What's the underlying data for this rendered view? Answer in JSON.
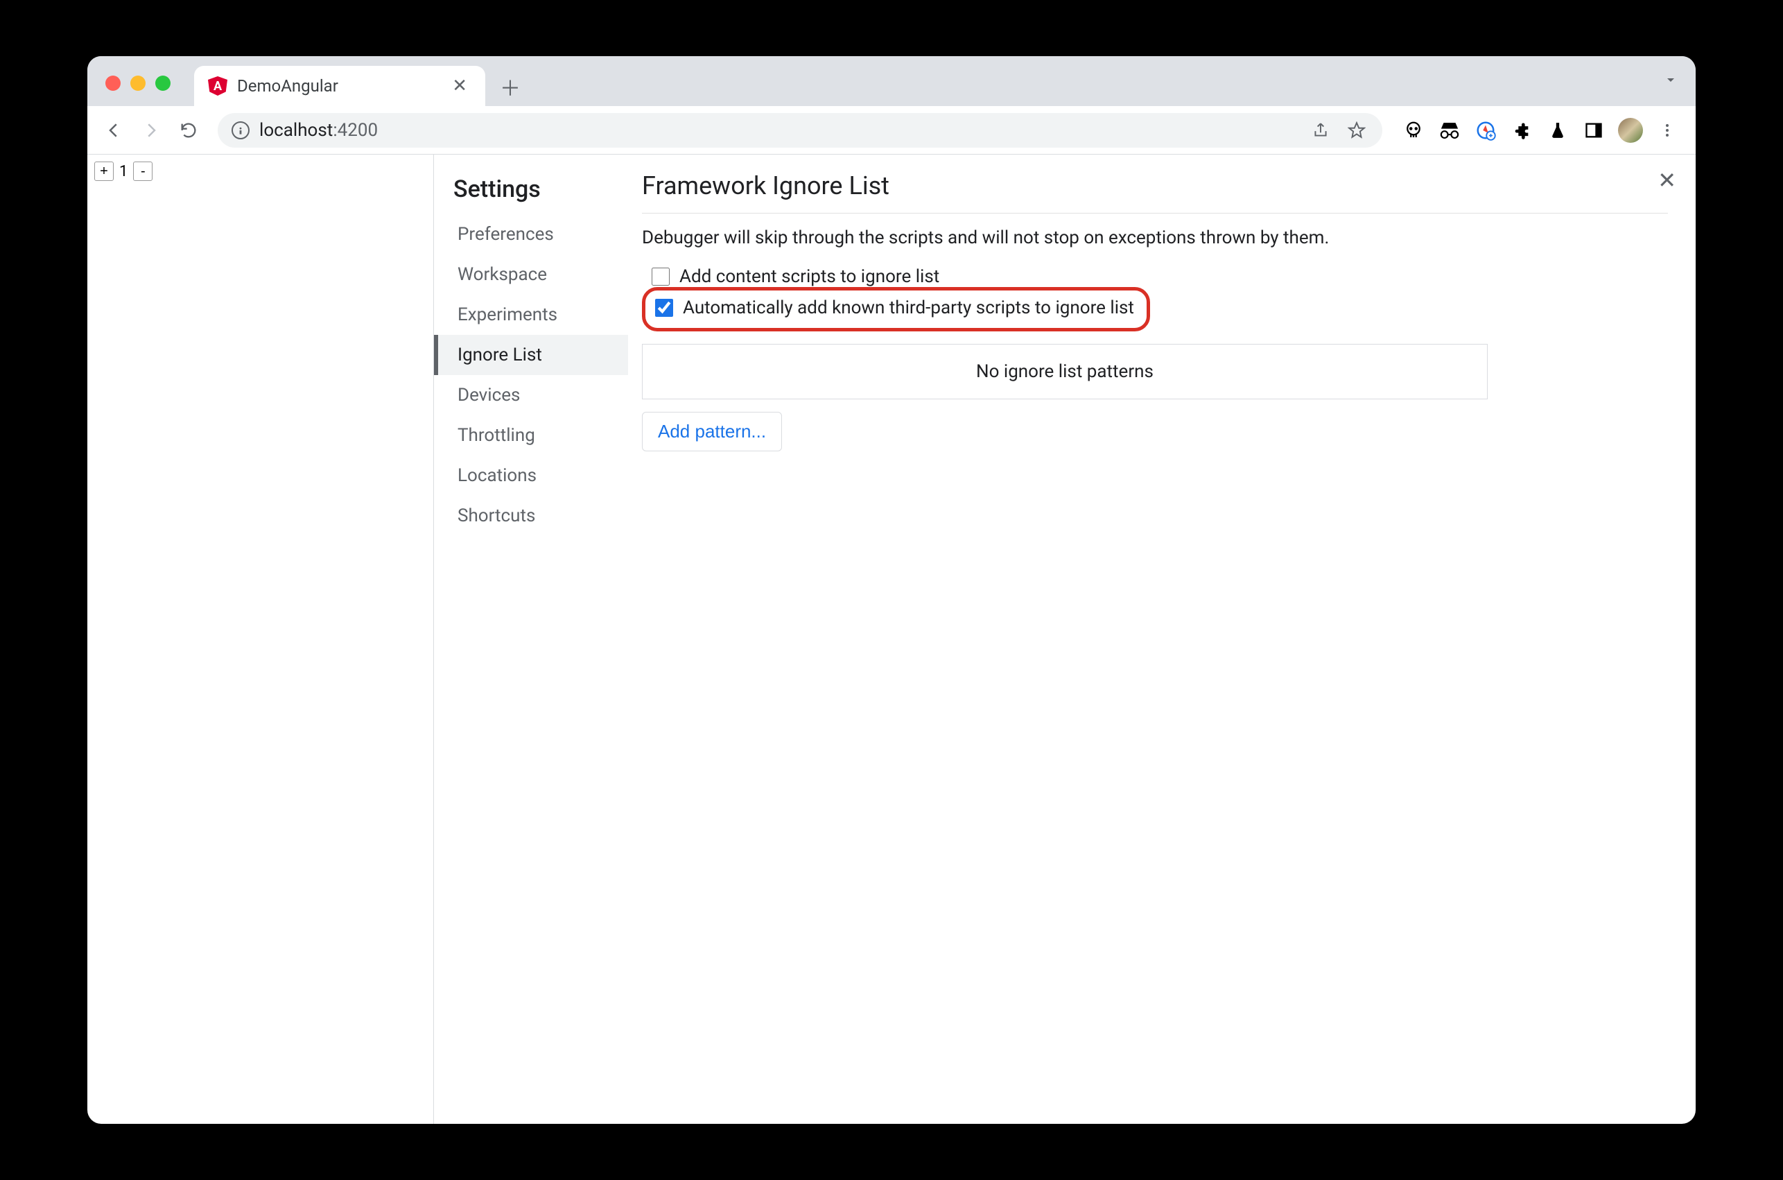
{
  "tab": {
    "title": "DemoAngular",
    "favicon_letter": "A"
  },
  "url": {
    "host": "localhost",
    "port": ":4200"
  },
  "counter": {
    "plus": "+",
    "value": "1",
    "minus": "-"
  },
  "settings": {
    "title": "Settings",
    "nav": [
      "Preferences",
      "Workspace",
      "Experiments",
      "Ignore List",
      "Devices",
      "Throttling",
      "Locations",
      "Shortcuts"
    ],
    "active_index": 3
  },
  "panel": {
    "title": "Framework Ignore List",
    "description": "Debugger will skip through the scripts and will not stop on exceptions thrown by them.",
    "checkbox1_label": "Add content scripts to ignore list",
    "checkbox1_checked": false,
    "checkbox2_label": "Automatically add known third-party scripts to ignore list",
    "checkbox2_checked": true,
    "empty_patterns": "No ignore list patterns",
    "add_pattern": "Add pattern..."
  }
}
